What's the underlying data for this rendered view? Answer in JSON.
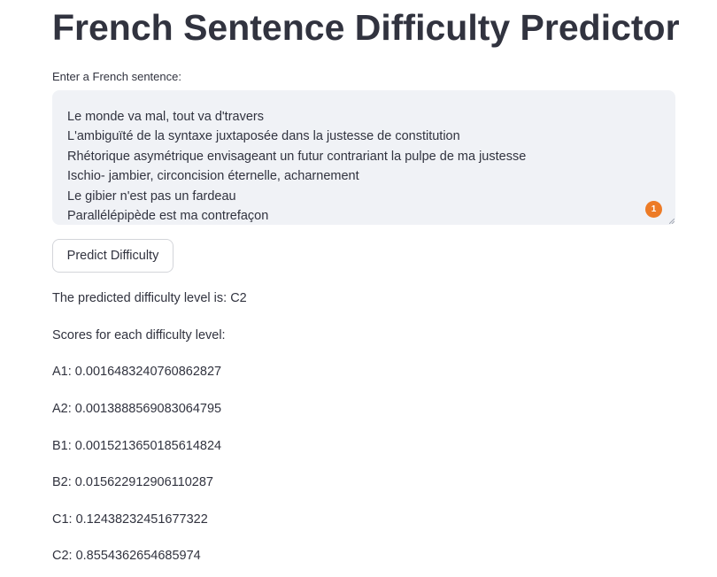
{
  "title": "French Sentence Difficulty Predictor",
  "input": {
    "label": "Enter a French sentence:",
    "value": "Le monde va mal, tout va d'travers\nL'ambiguïté de la syntaxe juxtaposée dans la justesse de constitution\nRhétorique asymétrique envisageant un futur contrariant la pulpe de ma justesse\nIschio- jambier, circoncision éternelle, acharnement\nLe gibier n'est pas un fardeau\nParallélépipède est ma contrefaçon",
    "badge_count": "1"
  },
  "button": {
    "label": "Predict Difficulty"
  },
  "result": {
    "predicted_text": "The predicted difficulty level is: C2",
    "scores_heading": "Scores for each difficulty level:",
    "scores": [
      "A1: 0.0016483240760862827",
      "A2: 0.0013888569083064795",
      "B1: 0.0015213650185614824",
      "B2: 0.015622912906110287",
      "C1: 0.12438232451677322",
      "C2: 0.8554362654685974"
    ]
  },
  "colors": {
    "text": "#31333f",
    "input_bg": "#f0f2f6",
    "badge": "#ed7b26",
    "button_border": "#d3d5da"
  }
}
